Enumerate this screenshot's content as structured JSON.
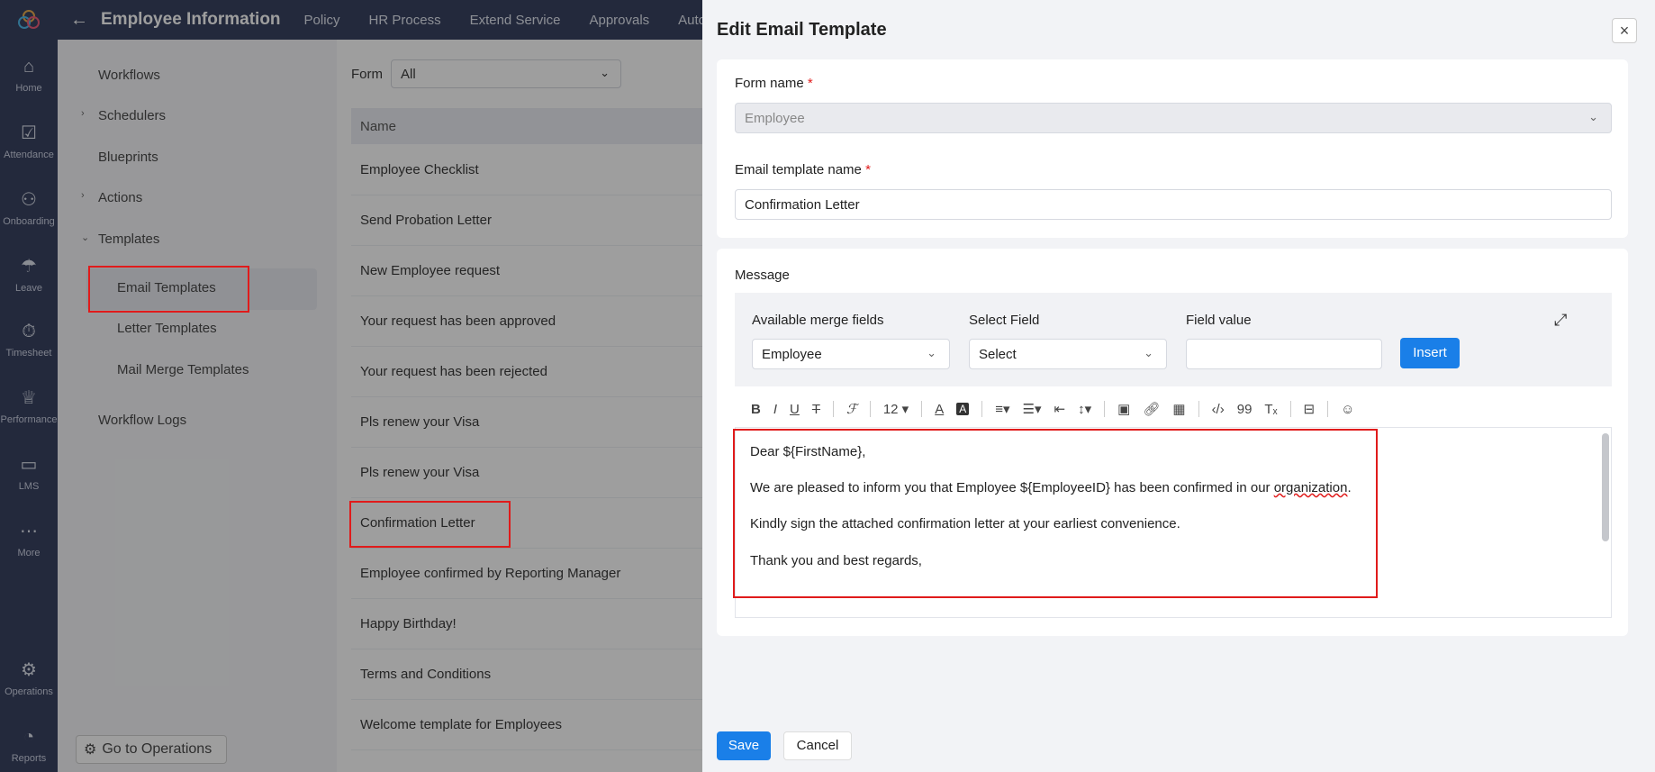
{
  "rail": {
    "items": [
      {
        "label": "Home",
        "icon": "home-icon",
        "glyph": "⌂"
      },
      {
        "label": "Attendance",
        "icon": "calendar-check-icon",
        "glyph": "☑"
      },
      {
        "label": "Onboarding",
        "icon": "handshake-icon",
        "glyph": "⚇"
      },
      {
        "label": "Leave",
        "icon": "umbrella-icon",
        "glyph": "☂"
      },
      {
        "label": "Timesheet",
        "icon": "stopwatch-icon",
        "glyph": "⏱"
      },
      {
        "label": "Performance",
        "icon": "trophy-icon",
        "glyph": "♕"
      },
      {
        "label": "LMS",
        "icon": "book-icon",
        "glyph": "▭"
      },
      {
        "label": "More",
        "icon": "more-dots-icon",
        "glyph": "⋯"
      },
      {
        "label": "Operations",
        "icon": "operations-icon",
        "glyph": "⚙"
      },
      {
        "label": "Reports",
        "icon": "pie-chart-icon",
        "glyph": "◔"
      }
    ]
  },
  "topbar": {
    "title": "Employee Information",
    "tabs": [
      "Policy",
      "HR Process",
      "Extend Service",
      "Approvals",
      "Auto"
    ]
  },
  "leftnav": {
    "workflows": "Workflows",
    "schedulers": "Schedulers",
    "blueprints": "Blueprints",
    "actions": "Actions",
    "templates": "Templates",
    "email_templates": "Email Templates",
    "letter_templates": "Letter Templates",
    "mail_merge_templates": "Mail Merge Templates",
    "workflow_logs": "Workflow Logs",
    "go_to_operations": "Go to Operations"
  },
  "list": {
    "form_label": "Form",
    "form_value": "All",
    "header": "Name",
    "rows": [
      "Employee Checklist",
      "Send Probation Letter",
      "New Employee request",
      "Your request has been approved",
      "Your request has been rejected",
      "Pls renew your Visa",
      "Pls renew your Visa",
      "Confirmation Letter",
      "Employee confirmed by Reporting Manager",
      "Happy Birthday!",
      "Terms and Conditions",
      "Welcome template for Employees"
    ]
  },
  "drawer": {
    "title": "Edit Email Template",
    "form_name_label": "Form name",
    "form_name_value": "Employee",
    "template_name_label": "Email template name",
    "template_name_value": "Confirmation Letter",
    "message_label": "Message",
    "merge_fields_label": "Available merge fields",
    "merge_fields_value": "Employee",
    "select_field_label": "Select Field",
    "select_field_value": "Select",
    "field_value_label": "Field value",
    "insert_label": "Insert",
    "font_size": "12",
    "body": {
      "line1": "Dear ${FirstName},",
      "line2a": "We are pleased to inform you that Employee ${EmployeeID} has been confirmed in our ",
      "line2b": "organization",
      "line2c": ".",
      "line3": "Kindly sign the attached confirmation letter at your earliest convenience.",
      "line4": "Thank you and best regards,"
    },
    "save_label": "Save",
    "cancel_label": "Cancel"
  },
  "colors": {
    "rail_bg": "#1f2a4d",
    "primary": "#1a7fe8",
    "highlight": "#e01b1b"
  }
}
